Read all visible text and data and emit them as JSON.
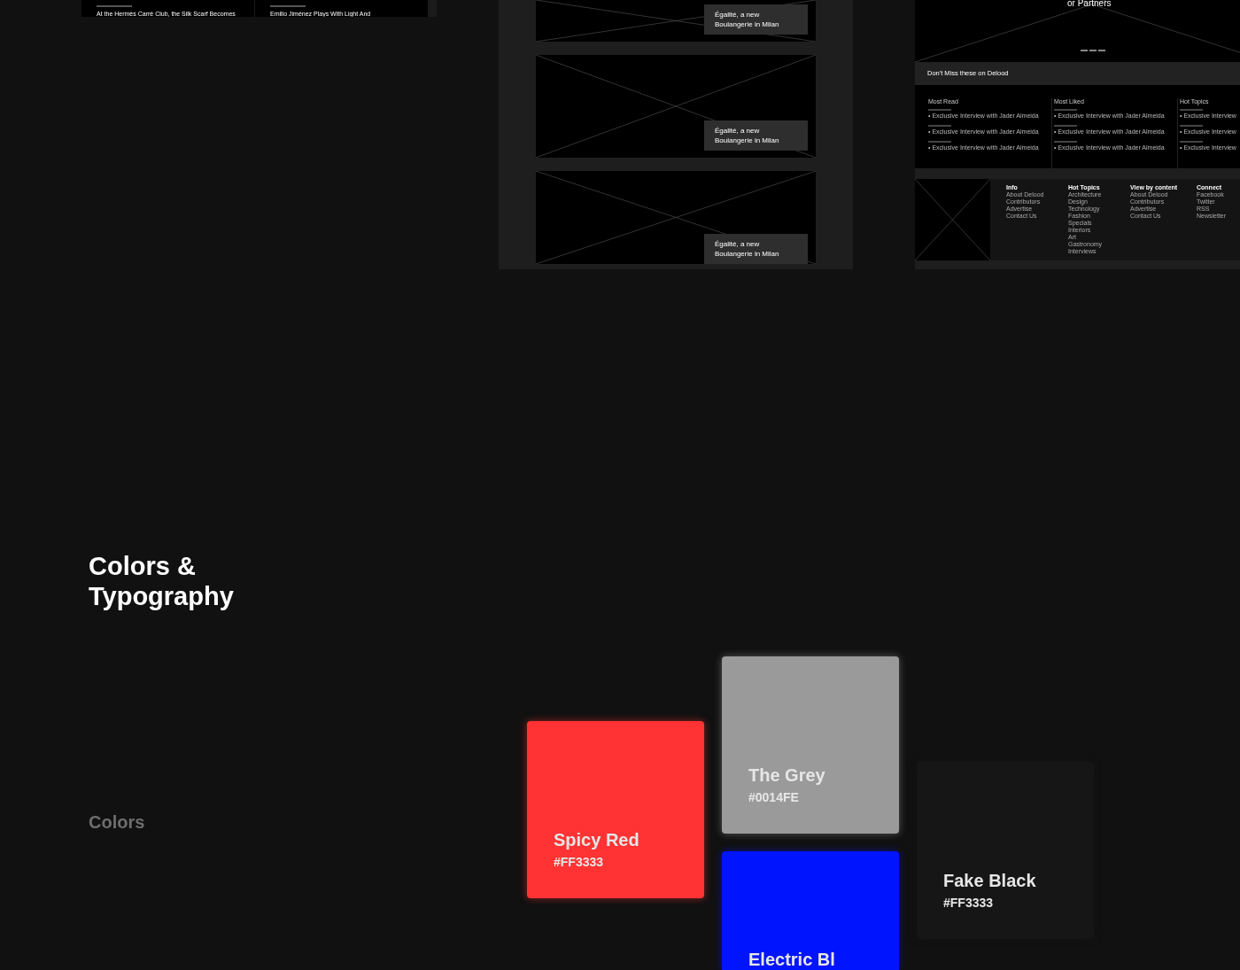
{
  "top_cards": [
    {
      "title": "At the Hermès Carré Club, the Silk Scarf Becomes"
    },
    {
      "title": "Emilio Jiménez Plays With Light And"
    }
  ],
  "article_list": {
    "captions": [
      "Égalité, a new Boulangerie in Milan",
      "Égalité, a new Boulangerie in Milan",
      "Égalité, a new Boulangerie in Milan"
    ]
  },
  "homepage": {
    "hero_text": "or Partners",
    "dont_miss_title": "Don't Miss these on Delood",
    "columns": [
      {
        "title": "Most Read",
        "items": [
          "• Exclusive Interview with Jader Almeida",
          "• Exclusive Interview with Jader Almeida",
          "• Exclusive Interview with Jader Almeida"
        ]
      },
      {
        "title": "Most Liked",
        "items": [
          "• Exclusive Interview with Jader Almeida",
          "• Exclusive Interview with Jader Almeida",
          "• Exclusive Interview with Jader Almeida"
        ]
      },
      {
        "title": "Hot Topics",
        "items": [
          "• Exclusive Interview",
          "• Exclusive Interview",
          "• Exclusive Interview"
        ]
      }
    ],
    "footer": [
      {
        "title": "Info",
        "links": [
          "About Delood",
          "Contributors",
          "Advertise",
          "Contact Us"
        ]
      },
      {
        "title": "Hot Topics",
        "links": [
          "Architecture",
          "Design",
          "Technology",
          "Fashion",
          "Specials",
          "Interiors",
          "Art",
          "Gastronomy",
          "Interviews"
        ]
      },
      {
        "title": "View by content",
        "links": [
          "About Delood",
          "Contributors",
          "Advertise",
          "Contact Us"
        ]
      },
      {
        "title": "Connect",
        "links": [
          "Facebook",
          "Twitter",
          "RSS",
          "Newsletter"
        ]
      }
    ]
  },
  "section_title": "Colors & Typography",
  "subsection_title": "Colors",
  "swatches": [
    {
      "name": "Spicy Red",
      "hex": "#FF3333",
      "color": "#ff3333"
    },
    {
      "name": "The Grey",
      "hex": "#0014FE",
      "color": "#9a9a9a"
    },
    {
      "name": "Electric Bl",
      "color": "#0014fe"
    },
    {
      "name": "Fake Black",
      "hex": "#FF3333",
      "color": "#161616"
    }
  ]
}
